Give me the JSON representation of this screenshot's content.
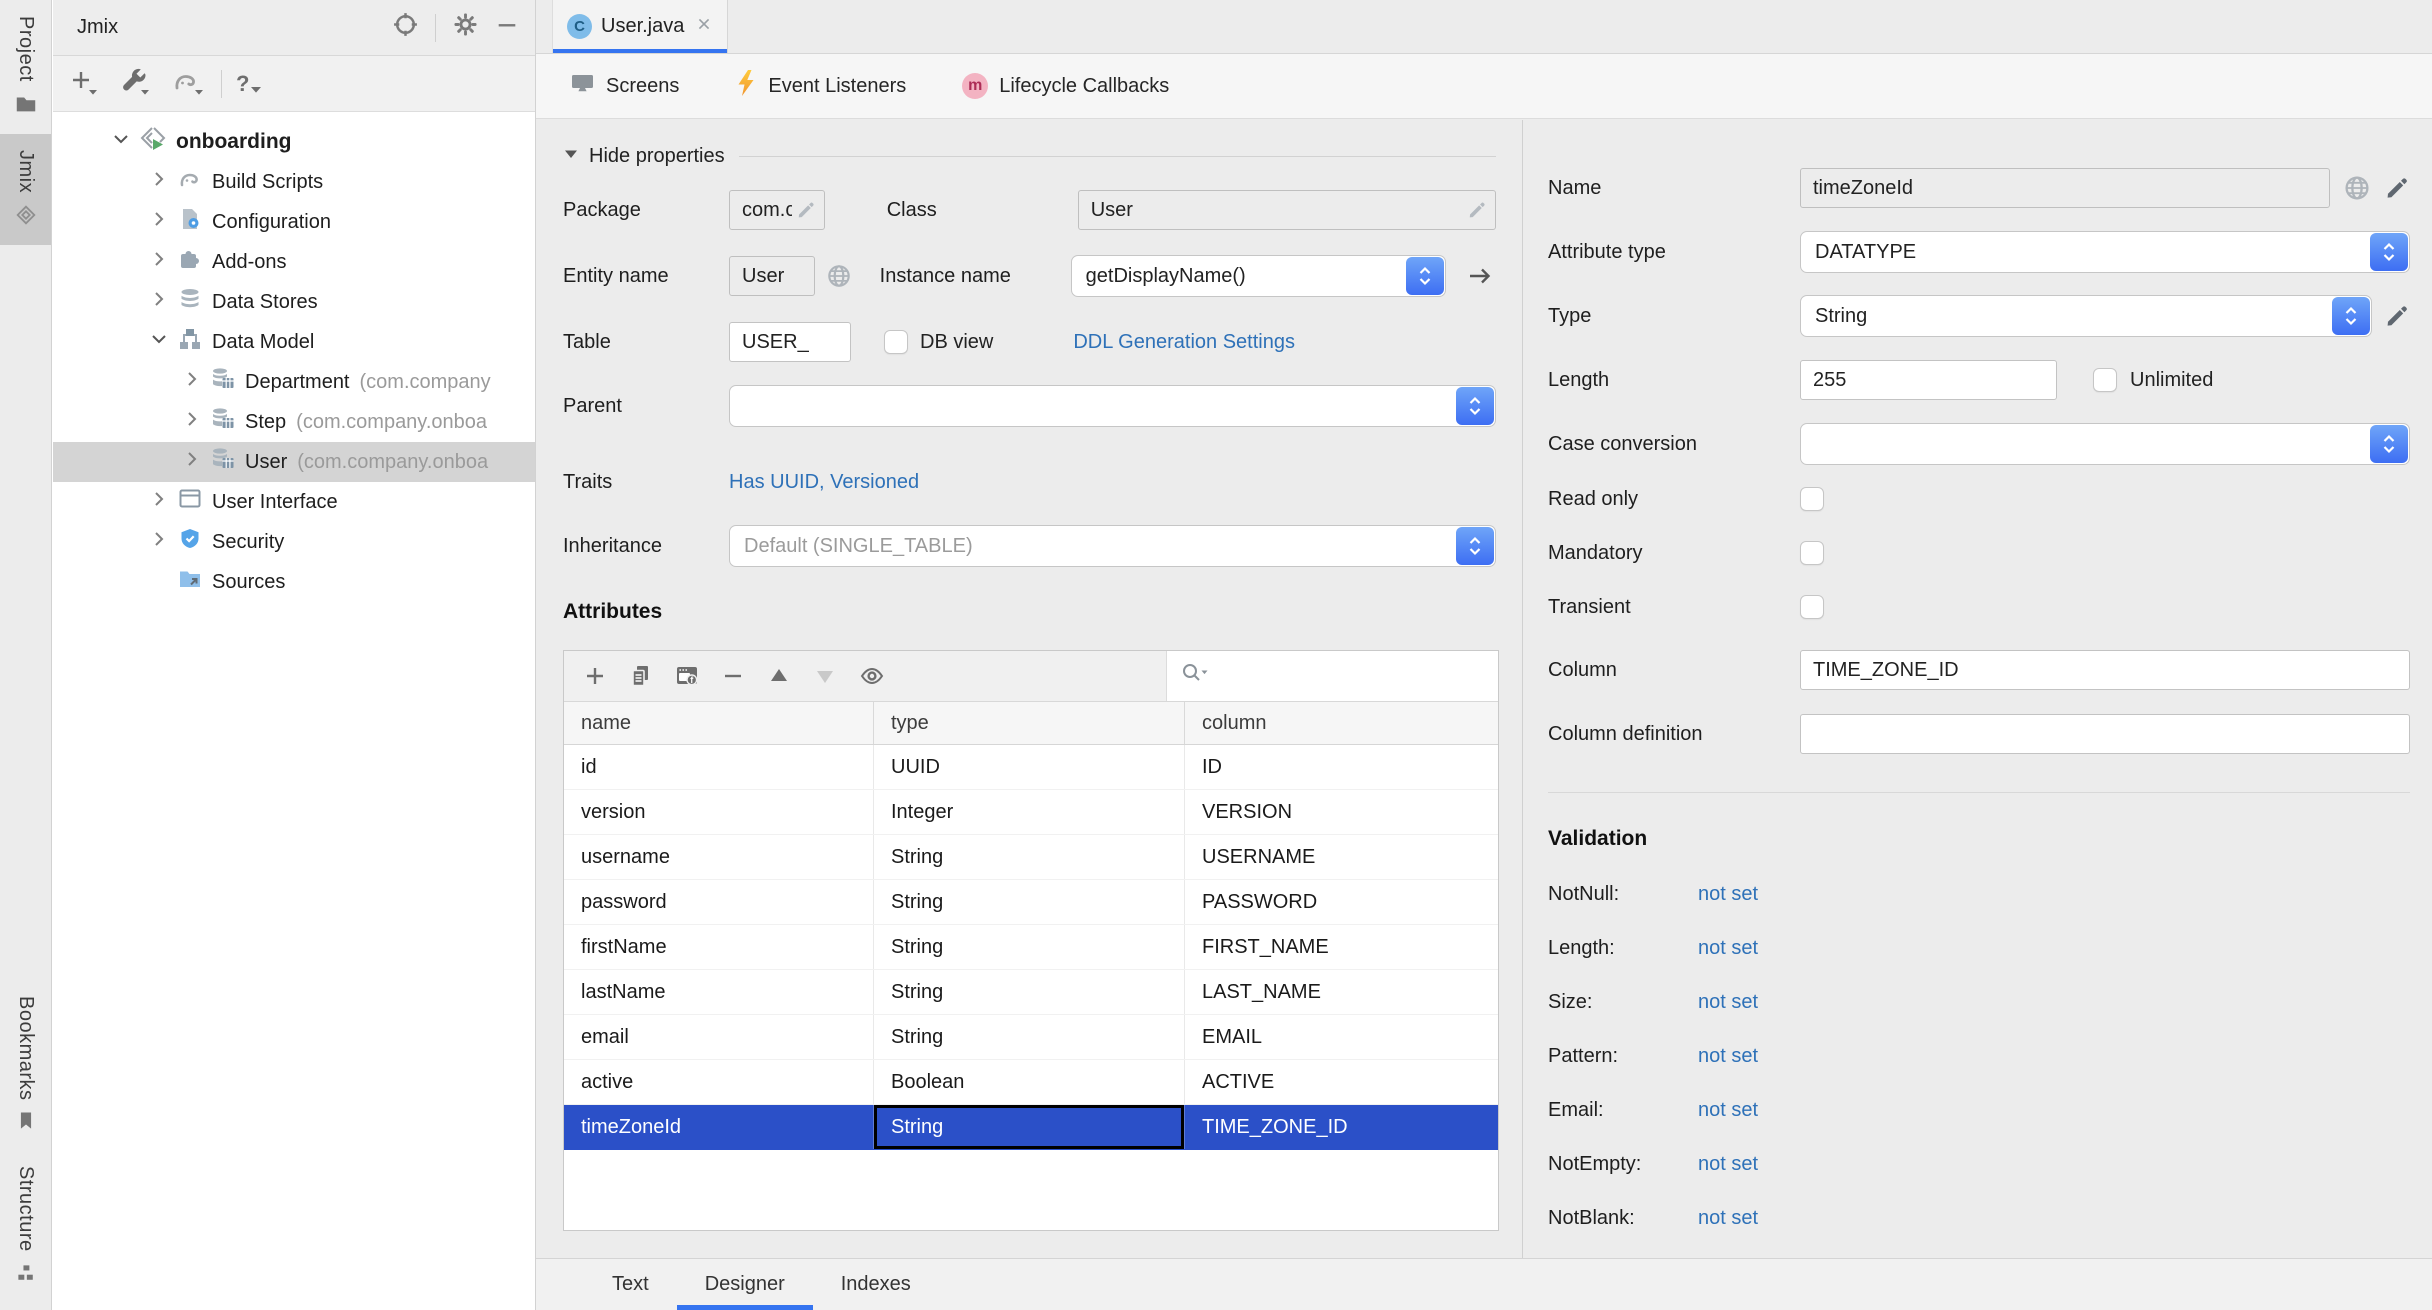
{
  "stripe": {
    "project": "Project",
    "jmix": "Jmix",
    "bookmarks": "Bookmarks",
    "structure": "Structure"
  },
  "tool_window": {
    "title": "Jmix",
    "tree": {
      "items": [
        {
          "label": "onboarding"
        },
        {
          "label": "Build Scripts"
        },
        {
          "label": "Configuration"
        },
        {
          "label": "Add-ons"
        },
        {
          "label": "Data Stores"
        },
        {
          "label": "Data Model"
        },
        {
          "label": "Department",
          "package": "(com.company"
        },
        {
          "label": "Step",
          "package": "(com.company.onboa"
        },
        {
          "label": "User",
          "package": "(com.company.onboa"
        },
        {
          "label": "User Interface"
        },
        {
          "label": "Security"
        },
        {
          "label": "Sources"
        }
      ]
    }
  },
  "editor": {
    "tab_title": "User.java",
    "toolbar": {
      "screens": "Screens",
      "event_listeners": "Event Listeners",
      "lifecycle_callbacks": "Lifecycle Callbacks"
    },
    "properties": {
      "hide": "Hide properties",
      "package_label": "Package",
      "package_value": "com.c",
      "class_label": "Class",
      "class_value": "User",
      "entity_name_label": "Entity name",
      "entity_name_value": "User",
      "instance_name_label": "Instance name",
      "instance_name_value": "getDisplayName()",
      "table_label": "Table",
      "table_value": "USER_",
      "db_view_label": "DB view",
      "ddl_link": "DDL Generation Settings",
      "parent_label": "Parent",
      "traits_label": "Traits",
      "traits_value": "Has UUID, Versioned",
      "inheritance_label": "Inheritance",
      "inheritance_placeholder": "Default (SINGLE_TABLE)"
    },
    "attributes": {
      "heading": "Attributes",
      "columns": [
        "name",
        "type",
        "column"
      ],
      "rows": [
        [
          "id",
          "UUID",
          "ID"
        ],
        [
          "version",
          "Integer",
          "VERSION"
        ],
        [
          "username",
          "String",
          "USERNAME"
        ],
        [
          "password",
          "String",
          "PASSWORD"
        ],
        [
          "firstName",
          "String",
          "FIRST_NAME"
        ],
        [
          "lastName",
          "String",
          "LAST_NAME"
        ],
        [
          "email",
          "String",
          "EMAIL"
        ],
        [
          "active",
          "Boolean",
          "ACTIVE"
        ],
        [
          "timeZoneId",
          "String",
          "TIME_ZONE_ID"
        ]
      ],
      "selected_row_index": 8
    },
    "bottom_tabs": {
      "text": "Text",
      "designer": "Designer",
      "indexes": "Indexes"
    }
  },
  "inspector": {
    "name_label": "Name",
    "name_value": "timeZoneId",
    "attribute_type_label": "Attribute type",
    "attribute_type_value": "DATATYPE",
    "type_label": "Type",
    "type_value": "String",
    "length_label": "Length",
    "length_value": "255",
    "unlimited_label": "Unlimited",
    "case_conversion_label": "Case conversion",
    "read_only_label": "Read only",
    "mandatory_label": "Mandatory",
    "transient_label": "Transient",
    "column_label": "Column",
    "column_value": "TIME_ZONE_ID",
    "column_definition_label": "Column definition",
    "validation": {
      "heading": "Validation",
      "items": [
        {
          "label": "NotNull:",
          "value": "not set"
        },
        {
          "label": "Length:",
          "value": "not set"
        },
        {
          "label": "Size:",
          "value": "not set"
        },
        {
          "label": "Pattern:",
          "value": "not set"
        },
        {
          "label": "Email:",
          "value": "not set"
        },
        {
          "label": "NotEmpty:",
          "value": "not set"
        },
        {
          "label": "NotBlank:",
          "value": "not set"
        }
      ]
    }
  },
  "colors": {
    "accent": "#3574F0",
    "selection_blue": "#2B50C8",
    "link_blue": "#2E71B8"
  }
}
